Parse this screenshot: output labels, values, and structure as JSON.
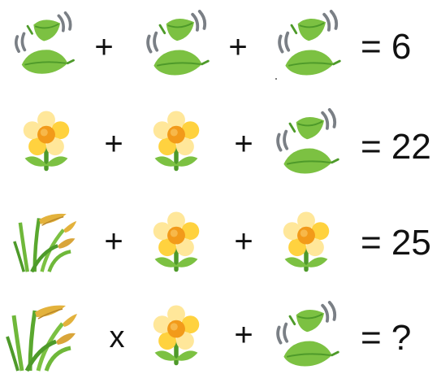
{
  "puzzle": {
    "icons": {
      "leaves": "falling-leaves-icon",
      "flower": "blossom-icon",
      "grass": "grass-sheaf-icon"
    },
    "colors": {
      "leaf_green": "#7cc142",
      "leaf_dark": "#4e9a2a",
      "petal_light": "#ffe79a",
      "petal_yellow": "#ffd23f",
      "flower_center": "#f29a1a",
      "grain_gold": "#e3b23c",
      "grass_green": "#6fb83a",
      "wind_gray": "#7a7f85"
    },
    "rows": [
      {
        "op1": "+",
        "op2": "+",
        "result": "= 6"
      },
      {
        "op1": "+",
        "op2": "+",
        "result": "= 22"
      },
      {
        "op1": "+",
        "op2": "+",
        "result": "= 25"
      },
      {
        "op1": "x",
        "op2": "+",
        "result": "= ?"
      }
    ]
  }
}
